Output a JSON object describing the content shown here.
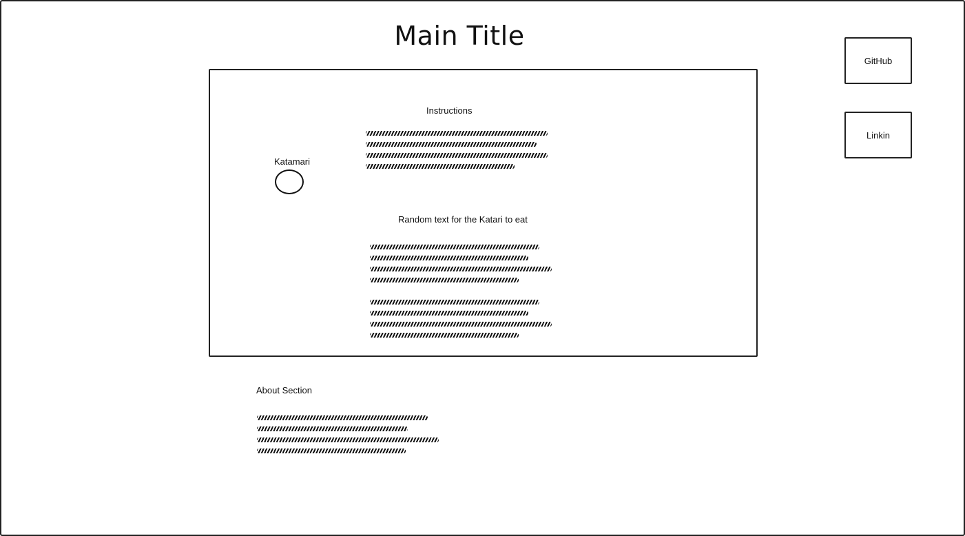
{
  "header": {
    "title": "Main Title"
  },
  "links": {
    "github_label": "GitHub",
    "linkin_label": "Linkin"
  },
  "game": {
    "katamari_label": "Katamari",
    "instructions_title": "Instructions",
    "random_text_title": "Random text for the Katari to eat"
  },
  "about": {
    "title": "About Section"
  }
}
